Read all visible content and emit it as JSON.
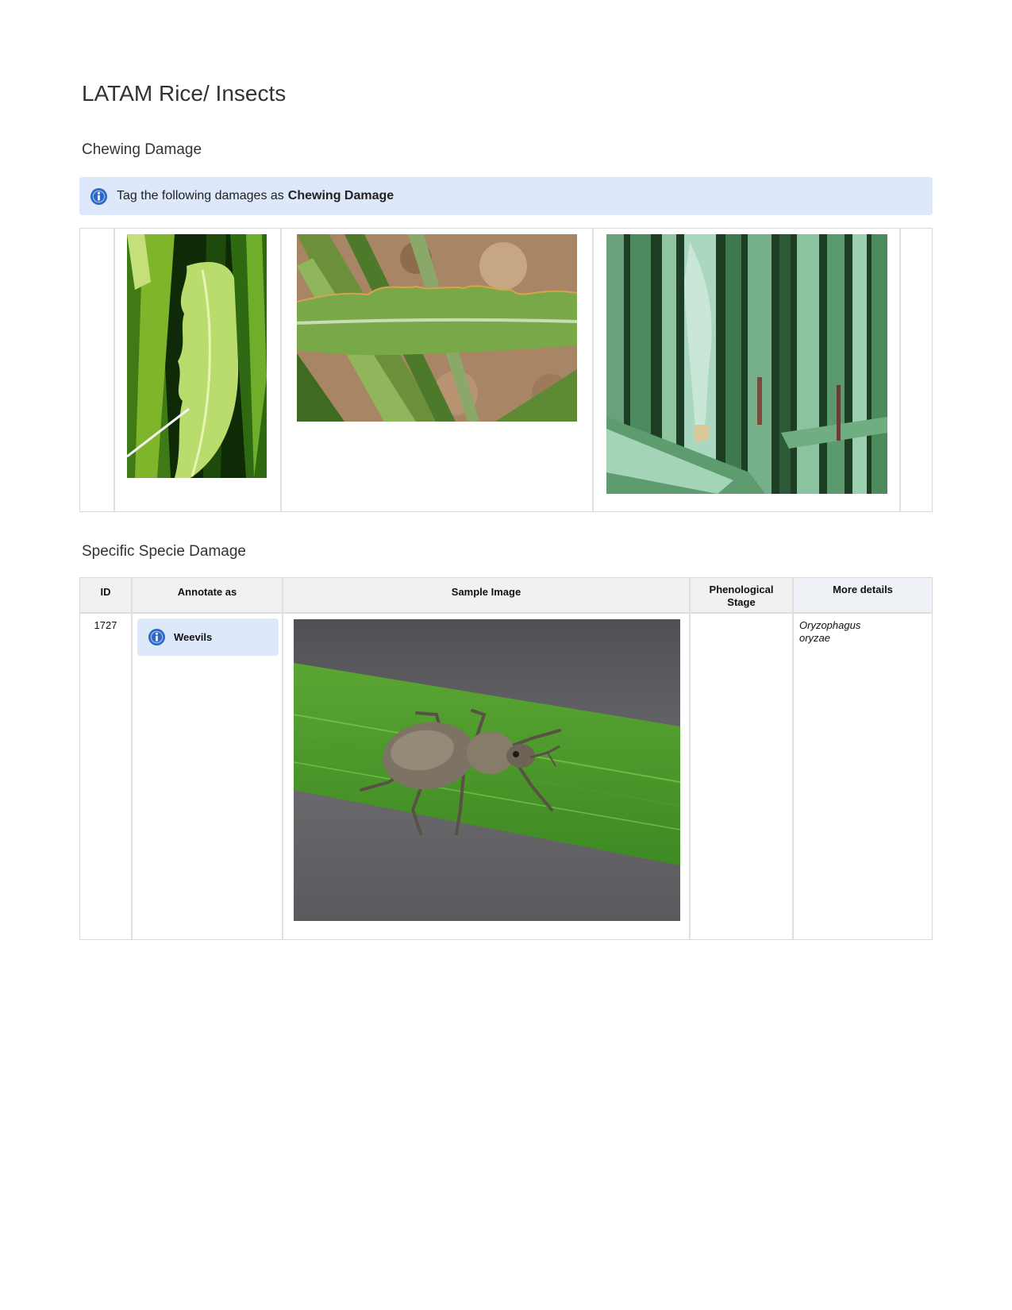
{
  "page": {
    "title": "LATAM Rice/ Insects"
  },
  "chewing": {
    "title": "Chewing Damage",
    "banner_text": "Tag the following damages as",
    "banner_bold": "Chewing Damage",
    "banner_icon": "info-icon",
    "images": [
      {
        "subject": "rice leaf with chewed notched edge",
        "icon": "photo"
      },
      {
        "subject": "rice leaf blade with scalloped chewed margin over soil",
        "icon": "photo"
      },
      {
        "subject": "rice stems with chewed leaf sheath",
        "icon": "photo"
      }
    ]
  },
  "species": {
    "title": "Specific Specie Damage",
    "headers": {
      "id": "ID",
      "annotate": "Annotate as",
      "sample": "Sample Image",
      "phen_line1": "Phenological",
      "phen_line2": "Stage",
      "more": "More details"
    },
    "rows": [
      {
        "id": "1727",
        "annotate": "Weevils",
        "phenological_stage": "",
        "details_line1": "Oryzophagus",
        "details_line2": "oryzae"
      }
    ]
  },
  "colors": {
    "banner_bg": "#dde8fa",
    "info_icon": "#2f67c8",
    "header_bg": "#f1f1f1",
    "border": "#d9d9d9"
  }
}
